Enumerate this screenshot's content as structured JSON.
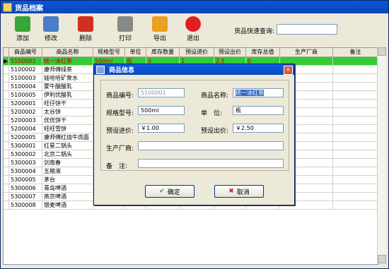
{
  "window": {
    "title": "货品档案"
  },
  "toolbar": {
    "buttons": [
      {
        "label": "添加",
        "icon": "add-icon",
        "color": "#3aa53a"
      },
      {
        "label": "修改",
        "icon": "edit-icon",
        "color": "#4a7cc8"
      },
      {
        "label": "删除",
        "icon": "delete-icon",
        "color": "#d03020"
      },
      {
        "label": "打印",
        "icon": "printer-icon",
        "color": "#888888"
      },
      {
        "label": "导出",
        "icon": "export-icon",
        "color": "#e8a020"
      },
      {
        "label": "退出",
        "icon": "exit-icon",
        "color": "#e02020"
      }
    ],
    "search_label": "货品快速查询:",
    "search_value": ""
  },
  "table": {
    "headers": [
      "商品编号",
      "商品名称",
      "规格型号",
      "单位",
      "库存数量",
      "预设进价",
      "预设出价",
      "库存总值",
      "生产厂商",
      "备注"
    ],
    "rows": [
      [
        "5100001",
        "统一冰红茶",
        "500ml",
        "瓶",
        "0",
        "1",
        "2.5",
        "0",
        "",
        ""
      ],
      [
        "5100002",
        "康师傅绿茶",
        "",
        "",
        "",
        "",
        "",
        "",
        "",
        ""
      ],
      [
        "5100003",
        "娃哈哈矿泉水",
        "",
        "",
        "",
        "",
        "",
        "",
        "",
        ""
      ],
      [
        "5100004",
        "蒙牛酸酸乳",
        "",
        "",
        "",
        "",
        "",
        "",
        "",
        ""
      ],
      [
        "5100005",
        "伊利优酸乳",
        "",
        "",
        "",
        "",
        "",
        "",
        "",
        ""
      ],
      [
        "5200001",
        "旺仔饼干",
        "",
        "",
        "",
        "",
        "",
        "",
        "",
        ""
      ],
      [
        "5200002",
        "太谷饼",
        "",
        "",
        "",
        "",
        "",
        "",
        "",
        ""
      ],
      [
        "5200003",
        "优优饼干",
        "",
        "",
        "",
        "",
        "",
        "",
        "",
        ""
      ],
      [
        "5200004",
        "旺旺雪饼",
        "",
        "",
        "",
        "",
        "",
        "",
        "",
        ""
      ],
      [
        "5200005",
        "康师傅红烧牛肉面",
        "",
        "",
        "",
        "",
        "",
        "",
        "",
        ""
      ],
      [
        "5300001",
        "红星二锅头",
        "",
        "",
        "",
        "",
        "",
        "",
        "",
        ""
      ],
      [
        "5300002",
        "北京二锅头",
        "",
        "",
        "",
        "",
        "",
        "",
        "",
        ""
      ],
      [
        "5300003",
        "剑南春",
        "",
        "",
        "",
        "",
        "",
        "",
        "",
        ""
      ],
      [
        "5300004",
        "五粮液",
        "",
        "",
        "",
        "",
        "",
        "",
        "",
        ""
      ],
      [
        "5300005",
        "茅台",
        "",
        "",
        "",
        "",
        "",
        "",
        "",
        ""
      ],
      [
        "5300006",
        "青岛啤酒",
        "",
        "",
        "",
        "",
        "",
        "",
        "",
        ""
      ],
      [
        "5300007",
        "燕京啤酒",
        "",
        "",
        "",
        "",
        "",
        "",
        "",
        ""
      ],
      [
        "5300008",
        "银麦啤酒",
        "",
        "",
        "",
        "",
        "",
        "",
        "",
        ""
      ]
    ]
  },
  "dialog": {
    "title": "商品信息",
    "code_label": "商品编号:",
    "code_value": "5100001",
    "name_label": "商品名称:",
    "name_value": "统一冰红茶",
    "spec_label": "规格型号:",
    "spec_value": "500ml",
    "unit_label": "单　位:",
    "unit_value": "瓶",
    "in_label": "预设进价:",
    "in_value": "￥1.00",
    "out_label": "预设出价:",
    "out_value": "￥2.50",
    "maker_label": "生产厂商:",
    "maker_value": "",
    "note_label": "备　注:",
    "note_value": "",
    "ok_label": "确定",
    "cancel_label": "取消"
  }
}
